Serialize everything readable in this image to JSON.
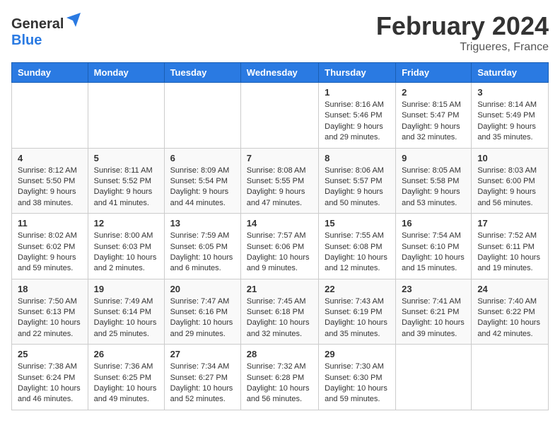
{
  "logo": {
    "text_general": "General",
    "text_blue": "Blue"
  },
  "header": {
    "month": "February 2024",
    "location": "Trigueres, France"
  },
  "weekdays": [
    "Sunday",
    "Monday",
    "Tuesday",
    "Wednesday",
    "Thursday",
    "Friday",
    "Saturday"
  ],
  "weeks": [
    [
      {
        "day": "",
        "info": ""
      },
      {
        "day": "",
        "info": ""
      },
      {
        "day": "",
        "info": ""
      },
      {
        "day": "",
        "info": ""
      },
      {
        "day": "1",
        "info": "Sunrise: 8:16 AM\nSunset: 5:46 PM\nDaylight: 9 hours\nand 29 minutes."
      },
      {
        "day": "2",
        "info": "Sunrise: 8:15 AM\nSunset: 5:47 PM\nDaylight: 9 hours\nand 32 minutes."
      },
      {
        "day": "3",
        "info": "Sunrise: 8:14 AM\nSunset: 5:49 PM\nDaylight: 9 hours\nand 35 minutes."
      }
    ],
    [
      {
        "day": "4",
        "info": "Sunrise: 8:12 AM\nSunset: 5:50 PM\nDaylight: 9 hours\nand 38 minutes."
      },
      {
        "day": "5",
        "info": "Sunrise: 8:11 AM\nSunset: 5:52 PM\nDaylight: 9 hours\nand 41 minutes."
      },
      {
        "day": "6",
        "info": "Sunrise: 8:09 AM\nSunset: 5:54 PM\nDaylight: 9 hours\nand 44 minutes."
      },
      {
        "day": "7",
        "info": "Sunrise: 8:08 AM\nSunset: 5:55 PM\nDaylight: 9 hours\nand 47 minutes."
      },
      {
        "day": "8",
        "info": "Sunrise: 8:06 AM\nSunset: 5:57 PM\nDaylight: 9 hours\nand 50 minutes."
      },
      {
        "day": "9",
        "info": "Sunrise: 8:05 AM\nSunset: 5:58 PM\nDaylight: 9 hours\nand 53 minutes."
      },
      {
        "day": "10",
        "info": "Sunrise: 8:03 AM\nSunset: 6:00 PM\nDaylight: 9 hours\nand 56 minutes."
      }
    ],
    [
      {
        "day": "11",
        "info": "Sunrise: 8:02 AM\nSunset: 6:02 PM\nDaylight: 9 hours\nand 59 minutes."
      },
      {
        "day": "12",
        "info": "Sunrise: 8:00 AM\nSunset: 6:03 PM\nDaylight: 10 hours\nand 2 minutes."
      },
      {
        "day": "13",
        "info": "Sunrise: 7:59 AM\nSunset: 6:05 PM\nDaylight: 10 hours\nand 6 minutes."
      },
      {
        "day": "14",
        "info": "Sunrise: 7:57 AM\nSunset: 6:06 PM\nDaylight: 10 hours\nand 9 minutes."
      },
      {
        "day": "15",
        "info": "Sunrise: 7:55 AM\nSunset: 6:08 PM\nDaylight: 10 hours\nand 12 minutes."
      },
      {
        "day": "16",
        "info": "Sunrise: 7:54 AM\nSunset: 6:10 PM\nDaylight: 10 hours\nand 15 minutes."
      },
      {
        "day": "17",
        "info": "Sunrise: 7:52 AM\nSunset: 6:11 PM\nDaylight: 10 hours\nand 19 minutes."
      }
    ],
    [
      {
        "day": "18",
        "info": "Sunrise: 7:50 AM\nSunset: 6:13 PM\nDaylight: 10 hours\nand 22 minutes."
      },
      {
        "day": "19",
        "info": "Sunrise: 7:49 AM\nSunset: 6:14 PM\nDaylight: 10 hours\nand 25 minutes."
      },
      {
        "day": "20",
        "info": "Sunrise: 7:47 AM\nSunset: 6:16 PM\nDaylight: 10 hours\nand 29 minutes."
      },
      {
        "day": "21",
        "info": "Sunrise: 7:45 AM\nSunset: 6:18 PM\nDaylight: 10 hours\nand 32 minutes."
      },
      {
        "day": "22",
        "info": "Sunrise: 7:43 AM\nSunset: 6:19 PM\nDaylight: 10 hours\nand 35 minutes."
      },
      {
        "day": "23",
        "info": "Sunrise: 7:41 AM\nSunset: 6:21 PM\nDaylight: 10 hours\nand 39 minutes."
      },
      {
        "day": "24",
        "info": "Sunrise: 7:40 AM\nSunset: 6:22 PM\nDaylight: 10 hours\nand 42 minutes."
      }
    ],
    [
      {
        "day": "25",
        "info": "Sunrise: 7:38 AM\nSunset: 6:24 PM\nDaylight: 10 hours\nand 46 minutes."
      },
      {
        "day": "26",
        "info": "Sunrise: 7:36 AM\nSunset: 6:25 PM\nDaylight: 10 hours\nand 49 minutes."
      },
      {
        "day": "27",
        "info": "Sunrise: 7:34 AM\nSunset: 6:27 PM\nDaylight: 10 hours\nand 52 minutes."
      },
      {
        "day": "28",
        "info": "Sunrise: 7:32 AM\nSunset: 6:28 PM\nDaylight: 10 hours\nand 56 minutes."
      },
      {
        "day": "29",
        "info": "Sunrise: 7:30 AM\nSunset: 6:30 PM\nDaylight: 10 hours\nand 59 minutes."
      },
      {
        "day": "",
        "info": ""
      },
      {
        "day": "",
        "info": ""
      }
    ]
  ]
}
